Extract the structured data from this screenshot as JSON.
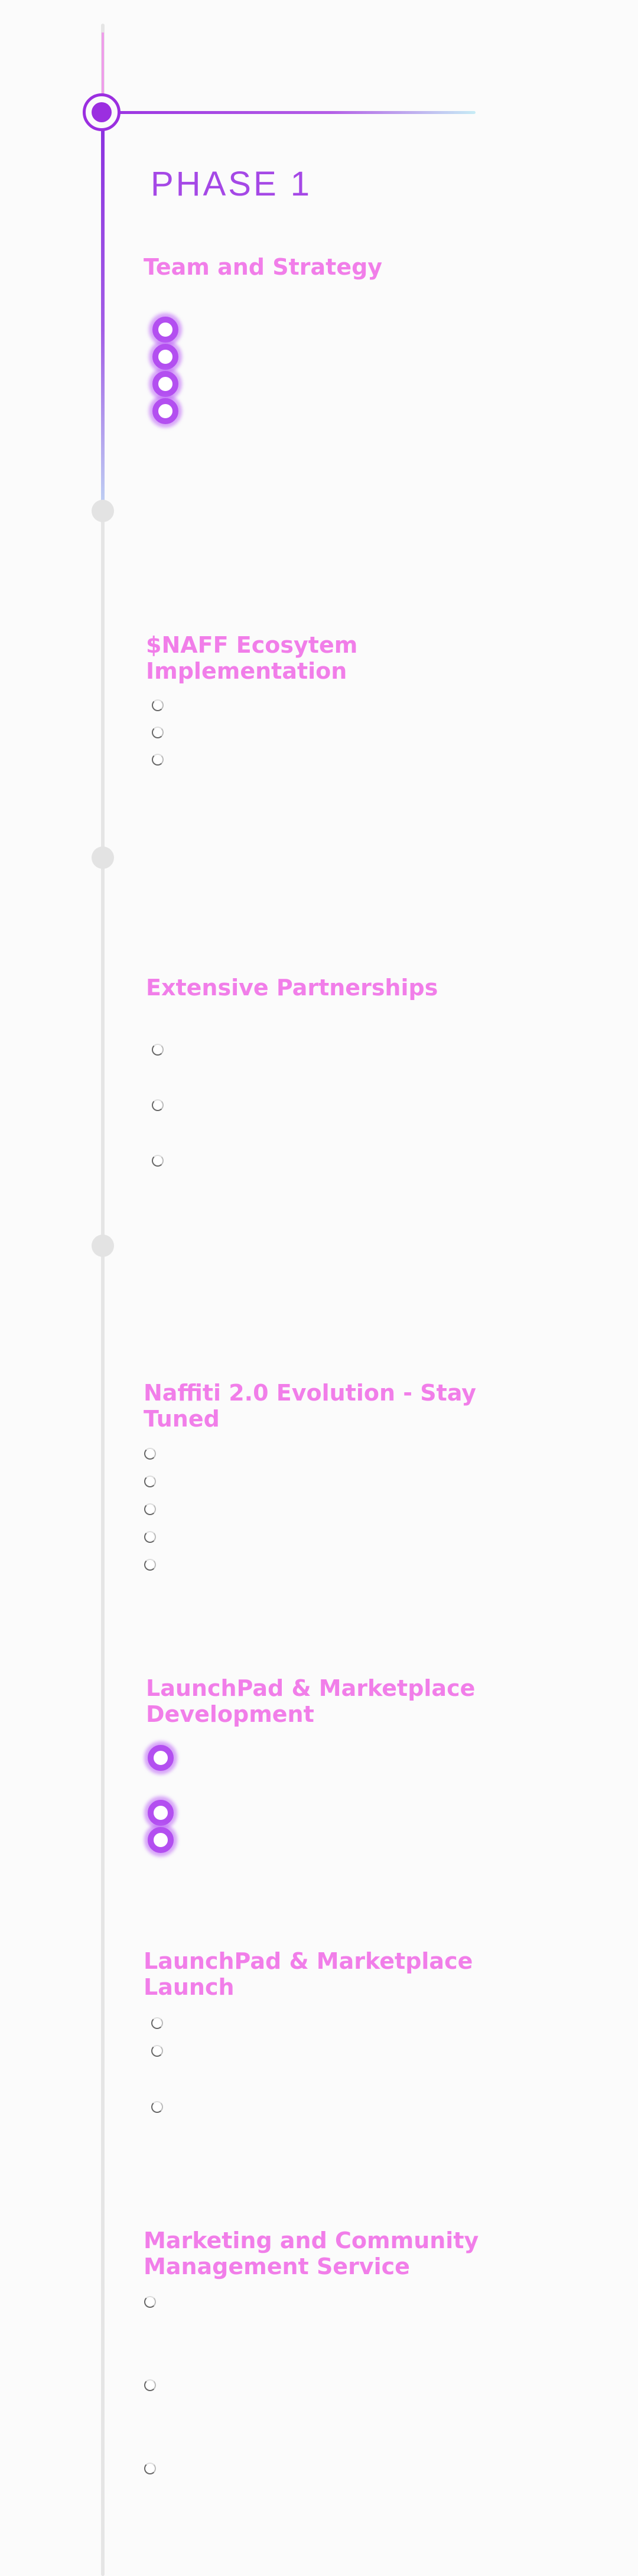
{
  "phase": {
    "title": "PHASE 1"
  },
  "sections": [
    {
      "title": "Team and Strategy",
      "bullet_count": 4,
      "bullet_style": "glow"
    },
    {
      "title": "$NAFF Ecosytem Implementation",
      "bullet_count": 3,
      "bullet_style": "hollow"
    },
    {
      "title": "Extensive Partnerships",
      "bullet_count": 3,
      "bullet_style": "hollow"
    },
    {
      "title": "Naffiti 2.0 Evolution - Stay Tuned",
      "bullet_count": 5,
      "bullet_style": "hollow"
    },
    {
      "title": "LaunchPad & Marketplace Development",
      "bullet_count": 3,
      "bullet_style": "glow"
    },
    {
      "title": "LaunchPad & Marketplace Launch",
      "bullet_count": 3,
      "bullet_style": "hollow"
    },
    {
      "title": "Marketing and Community Management Service",
      "bullet_count": 3,
      "bullet_style": "hollow"
    }
  ],
  "colors": {
    "accent_purple": "#9b2fe0",
    "heading_pink": "#f17ee9",
    "rail_grey": "#e5e5e5",
    "background": "#fbfbfb"
  }
}
